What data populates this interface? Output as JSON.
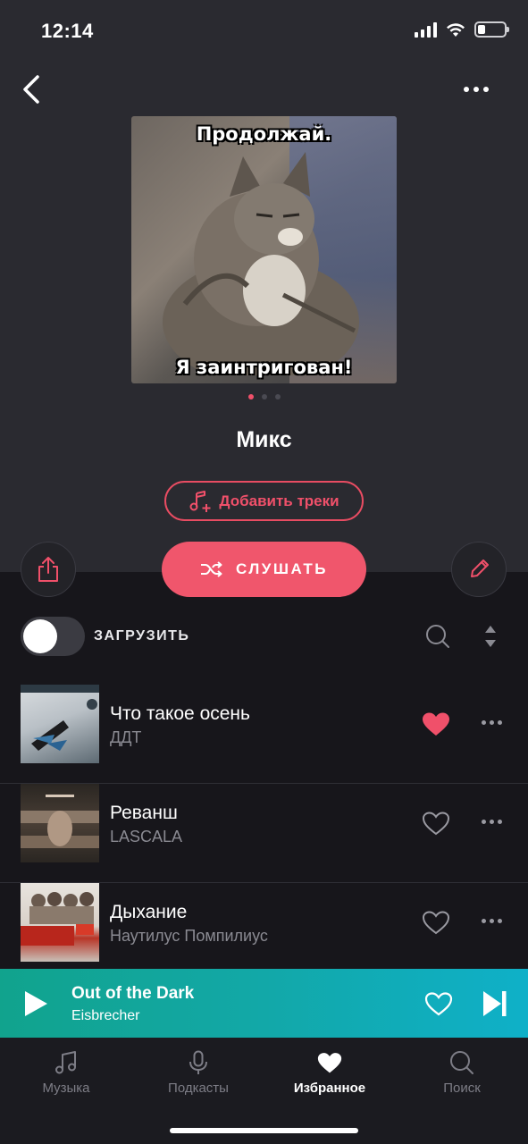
{
  "status_bar": {
    "time": "12:14"
  },
  "playlist": {
    "cover_caption_top": "Продолжай.",
    "cover_caption_bottom": "Я заинтригован!",
    "title": "Микс",
    "add_tracks_label": "Добавить треки",
    "listen_label": "СЛУШАТЬ",
    "download_label": "ЗАГРУЗИТЬ",
    "download_enabled": false,
    "carousel_pages": 3,
    "carousel_active": 1
  },
  "tracks": [
    {
      "title": "Что такое осень",
      "artist": "ДДТ",
      "liked": true
    },
    {
      "title": "Реванш",
      "artist": "LASCALA",
      "liked": false
    },
    {
      "title": "Дыхание",
      "artist": "Наутилус Помпилиус",
      "liked": false
    }
  ],
  "now_playing": {
    "title": "Out of the Dark",
    "artist": "Eisbrecher"
  },
  "tabs": [
    {
      "label": "Музыка",
      "icon": "music-note-icon",
      "active": false
    },
    {
      "label": "Подкасты",
      "icon": "microphone-icon",
      "active": false
    },
    {
      "label": "Избранное",
      "icon": "heart-icon",
      "active": true
    },
    {
      "label": "Поиск",
      "icon": "search-icon",
      "active": false
    }
  ],
  "colors": {
    "accent": "#f0566c",
    "player_gradient_start": "#11a38d",
    "player_gradient_end": "#0fb0c8"
  }
}
